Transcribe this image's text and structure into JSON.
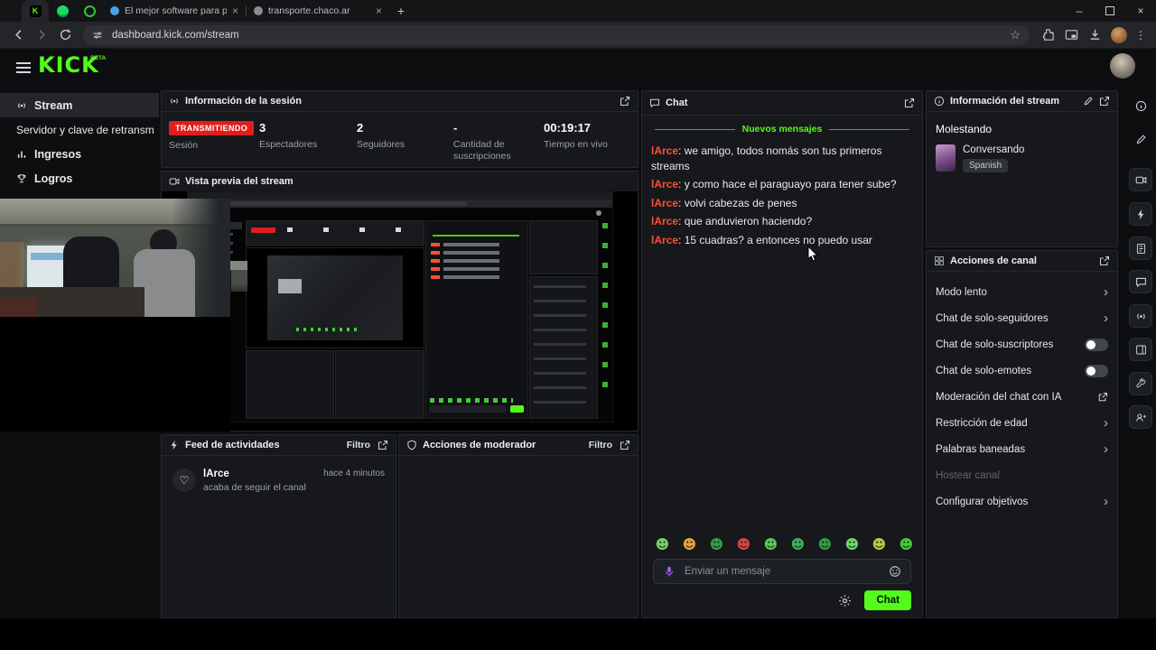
{
  "browser": {
    "pinned_tabs": [
      "kick-pinned-tab",
      "spotify-pinned-tab",
      "whatsapp-pinned-tab"
    ],
    "tabs": [
      {
        "title": "El mejor software para potencia"
      },
      {
        "title": "transporte.chaco.ar"
      }
    ],
    "url": "dashboard.kick.com/stream",
    "toolbar_icons": [
      "extensions-puzzle-icon",
      "media-controls-icon",
      "downloads-icon",
      "profile-avatar",
      "menu-kebab-icon"
    ]
  },
  "header": {
    "logo": "KICK",
    "beta": "BETA"
  },
  "sidebar": {
    "items": [
      {
        "label": "Stream"
      },
      {
        "label": "Servidor y clave de retransm"
      },
      {
        "label": "Ingresos"
      },
      {
        "label": "Logros"
      }
    ]
  },
  "session": {
    "title": "Información de la sesión",
    "badge": "TRANSMITIENDO",
    "badge_label": "Sesión",
    "stats": [
      {
        "value": "3",
        "label": "Espectadores"
      },
      {
        "value": "2",
        "label": "Seguidores"
      },
      {
        "value": "-",
        "label": "Cantidad de suscripciones"
      },
      {
        "value": "00:19:17",
        "label": "Tiempo en vivo"
      }
    ]
  },
  "preview": {
    "title": "Vista previa del stream"
  },
  "feed": {
    "title": "Feed de actividades",
    "filter": "Filtro",
    "items": [
      {
        "user": "lArce",
        "action": "acaba de seguir el canal",
        "time": "hace 4 minutos"
      }
    ]
  },
  "moderator": {
    "title": "Acciones de moderador",
    "filter": "Filtro"
  },
  "chat": {
    "title": "Chat",
    "divider": "Nuevos mensajes",
    "messages": [
      {
        "user": "lArce",
        "sep": ": ",
        "text": "we amigo, todos nomás son tus primeros streams"
      },
      {
        "user": "lArce",
        "sep": ": ",
        "text": "y como hace el paraguayo para tener sube?"
      },
      {
        "user": "lArce",
        "sep": ": ",
        "text": "volvi cabezas de penes"
      },
      {
        "user": "lArce",
        "sep": ": ",
        "text": "que anduvieron haciendo?"
      },
      {
        "user": "lArce",
        "sep": ": ",
        "text": "15 cuadras? a entonces no puedo usar"
      }
    ],
    "emote_styles": [
      "color:#7ad069",
      "color:#e6a23c",
      "color:#2f9e44",
      "color:#d64545",
      "color:#57c957",
      "color:#3fae5a",
      "color:#2f9e44",
      "color:#6bd66b",
      "color:#b7c93c",
      "color:#49c93c"
    ],
    "input_placeholder": "Enviar un mensaje",
    "send_button": "Chat"
  },
  "stream_info": {
    "title": "Información del stream",
    "stream_title": "Molestando",
    "category": "Conversando",
    "language": "Spanish"
  },
  "channel_actions": {
    "title": "Acciones de canal",
    "items": [
      {
        "label": "Modo lento",
        "control": "chevron"
      },
      {
        "label": "Chat de solo-seguidores",
        "control": "chevron"
      },
      {
        "label": "Chat de solo-suscriptores",
        "control": "toggle",
        "enabled": false
      },
      {
        "label": "Chat de solo-emotes",
        "control": "toggle",
        "enabled": false
      },
      {
        "label": "Moderación del chat con IA",
        "control": "external-link"
      },
      {
        "label": "Restricción de edad",
        "control": "chevron"
      },
      {
        "label": "Palabras baneadas",
        "control": "chevron"
      },
      {
        "label": "Hostear canal",
        "control": "none",
        "disabled": true
      },
      {
        "label": "Configurar objetivos",
        "control": "chevron"
      }
    ]
  },
  "right_rail": {
    "icons": [
      "info-icon",
      "edit-icon",
      "clips-icon",
      "quick-actions-icon",
      "activity-log-icon",
      "chat-icon",
      "go-live-icon",
      "layout-icon",
      "tools-icon",
      "community-icon"
    ]
  },
  "colors": {
    "accent_green": "#53fc18",
    "live_red": "#e11d1d",
    "chat_username": "#ff5032"
  }
}
